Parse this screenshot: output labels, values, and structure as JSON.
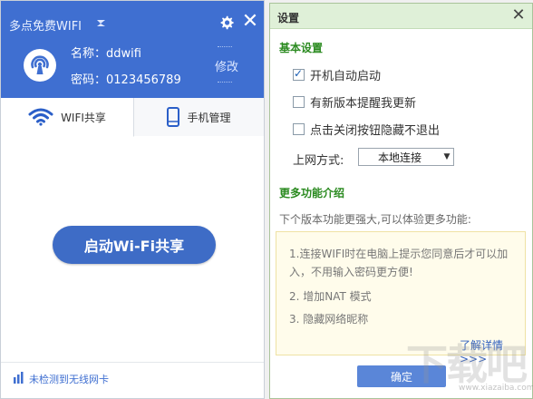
{
  "wifi_app": {
    "title": "多点免费WIFI",
    "ssid_label": "名称：",
    "ssid_value": "ddwifi",
    "password_label": "密码：",
    "password_value": "0123456789",
    "edit_label": "修改",
    "tabs": [
      {
        "label": "WIFI共享",
        "icon": "wifi-icon",
        "active": true
      },
      {
        "label": "手机管理",
        "icon": "phone-icon",
        "active": false
      }
    ],
    "start_button": "启动Wi-Fi共享",
    "status_text": "未检测到无线网卡",
    "colors": {
      "header": "#3f6fd1",
      "button": "#3e6cc6"
    }
  },
  "settings": {
    "title": "设置",
    "basic_section_title": "基本设置",
    "options": [
      {
        "label": "开机自动启动",
        "checked": true
      },
      {
        "label": "有新版本提醒我更新",
        "checked": false
      },
      {
        "label": "点击关闭按钮隐藏不退出",
        "checked": false
      }
    ],
    "connection_label": "上网方式:",
    "connection_value": "本地连接",
    "more_section_title": "更多功能介绍",
    "more_description": "下个版本功能更强大,可以体验更多功能:",
    "features": [
      "1.连接WIFI时在电脑上提示您同意后才可以加入，不用输入密码更方便!",
      "2. 增加NAT 模式",
      "3. 隐藏网络昵称"
    ],
    "more_link": "了解详情 >>>",
    "ok_button": "确定",
    "colors": {
      "section_title": "#2a8a1f",
      "titlebar": "#dff0d8"
    }
  },
  "watermark": {
    "text": "下载吧",
    "url": "www.xiazaiba.com"
  }
}
